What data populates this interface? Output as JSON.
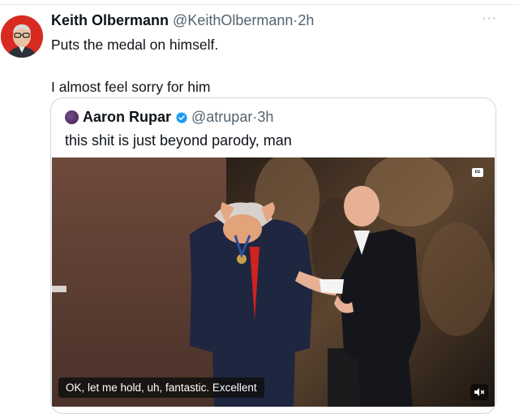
{
  "tweet": {
    "display_name": "Keith Olbermann",
    "handle": "@KeithOlbermann",
    "separator": "·",
    "time": "2h",
    "more": "···",
    "text": "Puts the medal on himself.\n\nI almost feel sorry for him"
  },
  "quote": {
    "display_name": "Aaron Rupar",
    "handle": "@atrupar",
    "separator": "·",
    "time": "3h",
    "text": "this shit is just beyond parody, man",
    "media": {
      "cc_label": "cc",
      "caption": "OK, let me hold, uh, fantastic. Excellent",
      "mute_icon": "speaker-muted-icon"
    }
  },
  "colors": {
    "avatar_bg": "#d72a20",
    "verified": "#1d9bf0",
    "secondary_text": "#536471",
    "card_border": "#cfd9de"
  }
}
